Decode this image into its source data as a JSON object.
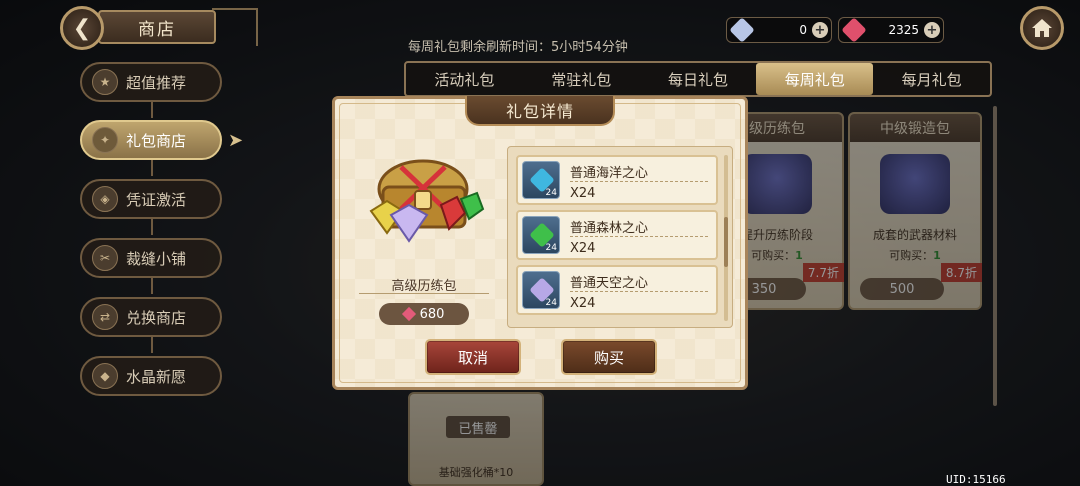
{
  "header": {
    "title": "商店"
  },
  "currency": {
    "crystal": "0",
    "gem": "2325"
  },
  "sidebar": {
    "items": [
      {
        "label": "超值推荐",
        "icon": "star-icon"
      },
      {
        "label": "礼包商店",
        "icon": "gift-icon",
        "active": true
      },
      {
        "label": "凭证激活",
        "icon": "ticket-icon"
      },
      {
        "label": "裁缝小铺",
        "icon": "needle-icon"
      },
      {
        "label": "兑换商店",
        "icon": "exchange-icon"
      },
      {
        "label": "水晶新愿",
        "icon": "crystal-icon"
      }
    ]
  },
  "refresh_text": "每周礼包剩余刷新时间：5小时54分钟",
  "tabs": [
    "活动礼包",
    "常驻礼包",
    "每日礼包",
    "每周礼包",
    "每月礼包"
  ],
  "active_tab": "每周礼包",
  "cards": [
    {
      "title": "级历练包",
      "desc": "提升历练阶段",
      "limit_label": "可购买：",
      "limit": "1",
      "price": "350",
      "discount": "7.7折"
    },
    {
      "title": "中级锻造包",
      "desc": "成套的武器材料",
      "limit_label": "可购买：",
      "limit": "1",
      "price": "500",
      "discount": "8.7折"
    }
  ],
  "sold_card": {
    "tag": "已售罄",
    "name": "基础强化桶*10"
  },
  "uid": "UID:15166",
  "modal": {
    "title": "礼包详情",
    "pack_name": "高级历练包",
    "price": "680",
    "items": [
      {
        "name": "普通海洋之心",
        "qty": "X24",
        "count": "24",
        "color": "#3fb7e0"
      },
      {
        "name": "普通森林之心",
        "qty": "X24",
        "count": "24",
        "color": "#3fbf4a"
      },
      {
        "name": "普通天空之心",
        "qty": "X24",
        "count": "24",
        "color": "#b7a8e6"
      }
    ],
    "cancel_label": "取消",
    "buy_label": "购买"
  },
  "colors": {
    "crystal": "#b8c6e6",
    "gem": "#e0506c",
    "accent": "#a8855b"
  }
}
